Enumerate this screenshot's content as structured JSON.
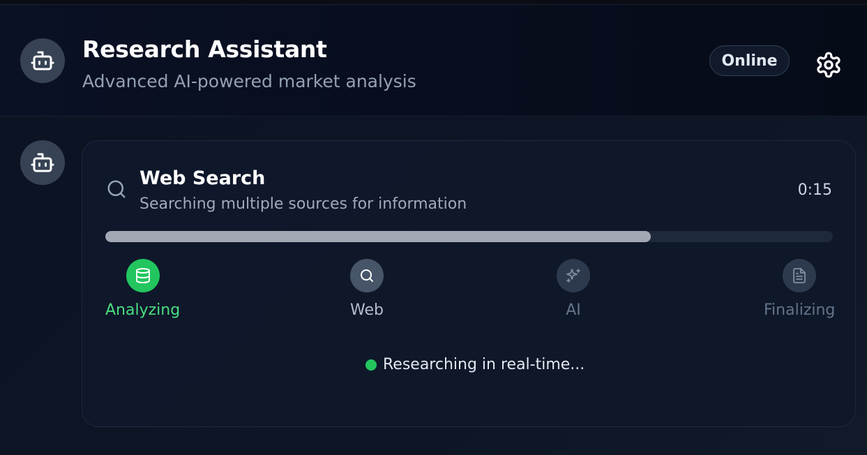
{
  "header": {
    "title": "Research Assistant",
    "subtitle": "Advanced AI-powered market analysis",
    "status": "Online",
    "avatar_icon": "bot-icon",
    "settings_icon": "gear-icon"
  },
  "message": {
    "avatar_icon": "bot-icon",
    "card": {
      "icon": "search-icon",
      "title": "Web Search",
      "subtitle": "Searching multiple sources for information",
      "elapsed": "0:15",
      "progress": 0.75
    },
    "steps": [
      {
        "label": "Analyzing",
        "icon": "database-icon",
        "state": "active"
      },
      {
        "label": "Web",
        "icon": "search-icon",
        "state": "next"
      },
      {
        "label": "AI",
        "icon": "sparkles-icon",
        "state": "pending"
      },
      {
        "label": "Finalizing",
        "icon": "document-icon",
        "state": "pending"
      }
    ],
    "live_status": "Researching in real-time..."
  },
  "colors": {
    "background": "#0b1120",
    "accent_green": "#22c55e",
    "progress_fill": "#a3a9b4",
    "card_border": "#1e293b"
  }
}
